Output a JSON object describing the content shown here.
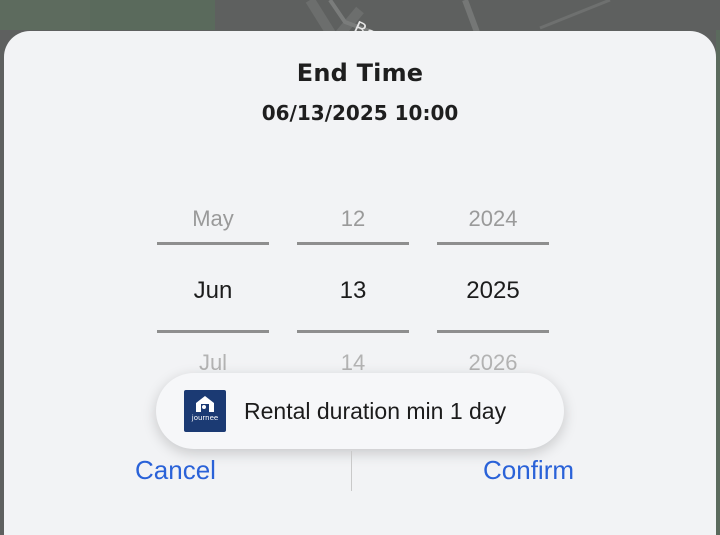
{
  "background": {
    "map_label": "Ba"
  },
  "dialog": {
    "title": "End Time",
    "datetime": "06/13/2025 10:00",
    "picker": {
      "month": {
        "prev": "May",
        "current": "Jun",
        "next": "Jul"
      },
      "day": {
        "prev": "12",
        "current": "13",
        "next": "14"
      },
      "year": {
        "prev": "2024",
        "current": "2025",
        "next": "2026"
      }
    },
    "cancel_label": "Cancel",
    "confirm_label": "Confirm"
  },
  "toast": {
    "logo_text": "journee",
    "message": "Rental duration min 1 day"
  },
  "colors": {
    "accent": "#2a62d8",
    "sheet": "#f2f3f5",
    "logo_bg": "#1b3a73"
  }
}
